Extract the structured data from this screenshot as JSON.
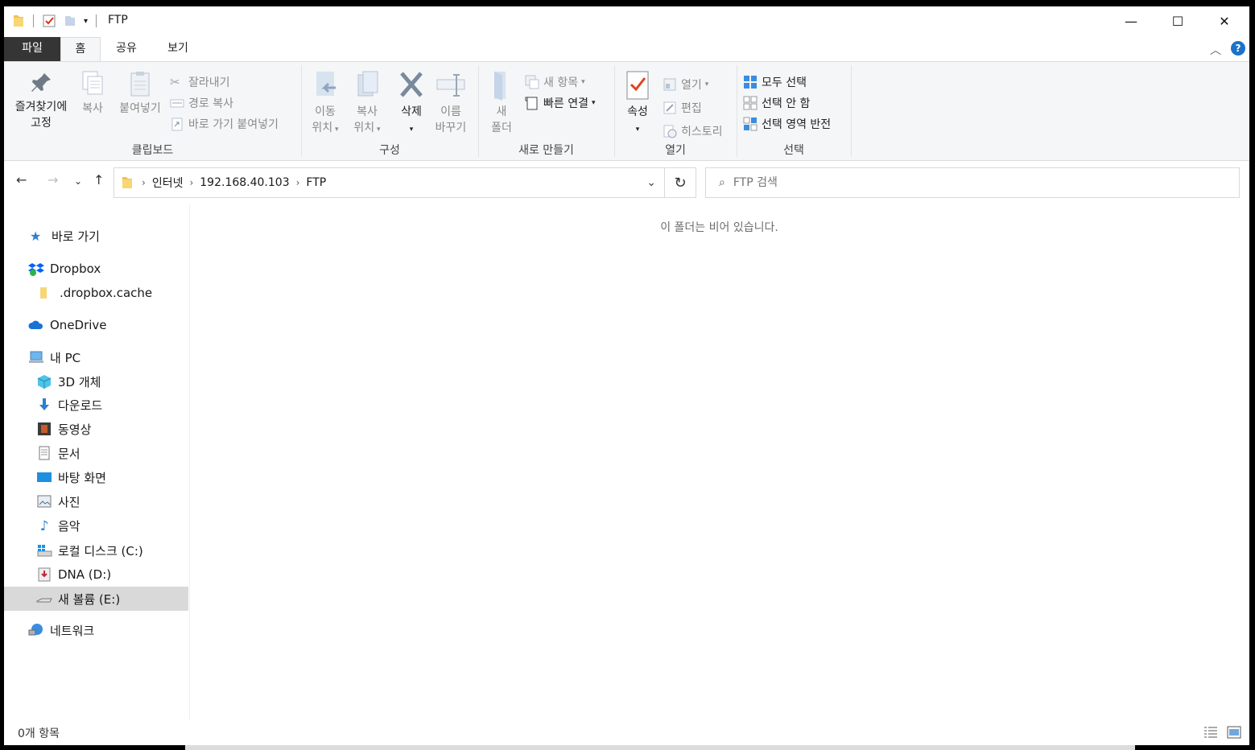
{
  "window": {
    "title": "FTP",
    "minimize": "—",
    "maximize": "☐",
    "close": "✕"
  },
  "tabs": {
    "file": "파일",
    "home": "홈",
    "share": "공유",
    "view": "보기"
  },
  "ribbon": {
    "clipboard": {
      "pin_line1": "즐겨찾기에",
      "pin_line2": "고정",
      "copy": "복사",
      "paste": "붙여넣기",
      "cut": "잘라내기",
      "copy_path": "경로 복사",
      "paste_shortcut": "바로 가기 붙여넣기",
      "label": "클립보드"
    },
    "organize": {
      "move_line1": "이동",
      "move_line2": "위치",
      "copy_line1": "복사",
      "copy_line2": "위치",
      "delete": "삭제",
      "rename_line1": "이름",
      "rename_line2": "바꾸기",
      "label": "구성"
    },
    "new": {
      "folder_line1": "새",
      "folder_line2": "폴더",
      "new_item": "새 항목",
      "easy_access": "빠른 연결",
      "label": "새로 만들기"
    },
    "open": {
      "properties": "속성",
      "open": "열기",
      "edit": "편집",
      "history": "히스토리",
      "label": "열기"
    },
    "select": {
      "select_all": "모두 선택",
      "select_none": "선택 안 함",
      "invert": "선택 영역 반전",
      "label": "선택"
    }
  },
  "address": {
    "crumbs": [
      "인터넷",
      "192.168.40.103",
      "FTP"
    ]
  },
  "search": {
    "placeholder": "FTP 검색"
  },
  "sidebar": {
    "items": [
      {
        "label": "바로 가기"
      },
      {
        "label": "Dropbox"
      },
      {
        "label": ".dropbox.cache"
      },
      {
        "label": "OneDrive"
      },
      {
        "label": "내 PC"
      },
      {
        "label": "3D 개체"
      },
      {
        "label": "다운로드"
      },
      {
        "label": "동영상"
      },
      {
        "label": "문서"
      },
      {
        "label": "바탕 화면"
      },
      {
        "label": "사진"
      },
      {
        "label": "음악"
      },
      {
        "label": "로컬 디스크 (C:)"
      },
      {
        "label": "DNA (D:)"
      },
      {
        "label": "새 볼륨 (E:)"
      },
      {
        "label": "네트워크"
      }
    ]
  },
  "content": {
    "empty_message": "이 폴더는 비어 있습니다."
  },
  "status": {
    "count": "0개 항목"
  }
}
